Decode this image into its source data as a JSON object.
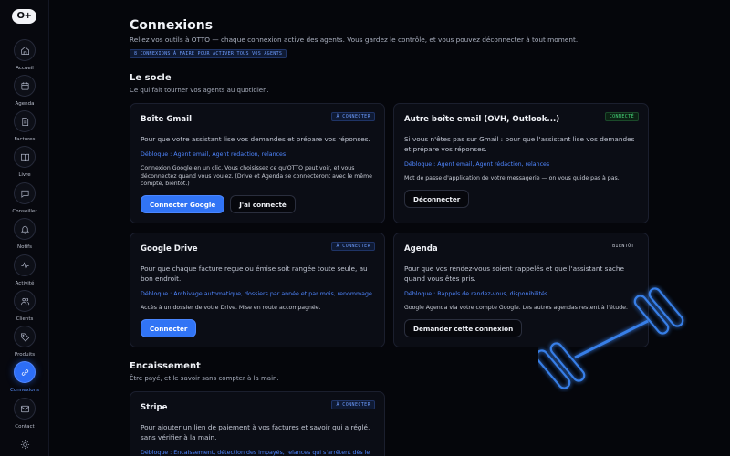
{
  "sidebar": {
    "logo": "O+",
    "items": [
      {
        "label": "Accueil",
        "icon": "home-icon"
      },
      {
        "label": "Agenda",
        "icon": "calendar-icon"
      },
      {
        "label": "Factures",
        "icon": "invoice-icon"
      },
      {
        "label": "Livre",
        "icon": "book-icon"
      },
      {
        "label": "Conseiller",
        "icon": "chat-icon"
      },
      {
        "label": "Notifs",
        "icon": "bell-icon"
      },
      {
        "label": "Activité",
        "icon": "activity-icon"
      },
      {
        "label": "Clients",
        "icon": "users-icon"
      },
      {
        "label": "Produits",
        "icon": "tag-icon"
      },
      {
        "label": "Connexions",
        "icon": "link-icon",
        "active": true
      },
      {
        "label": "Contact",
        "icon": "mail-icon"
      },
      {
        "label": "",
        "icon": "sun-icon"
      }
    ]
  },
  "page": {
    "title": "Connexions",
    "subtitle": "Reliez vos outils à OTTO — chaque connexion active des agents. Vous gardez le contrôle, et vous pouvez déconnecter à tout moment.",
    "count_badge": "8 CONNEXIONS À FAIRE POUR ACTIVER TOUS VOS AGENTS"
  },
  "sections": {
    "socle": {
      "title": "Le socle",
      "subtitle": "Ce qui fait tourner vos agents au quotidien."
    },
    "encaissement": {
      "title": "Encaissement",
      "subtitle": "Être payé, et le savoir sans compter à la main."
    }
  },
  "cards": {
    "gmail": {
      "title": "Boîte Gmail",
      "status": "À CONNECTER",
      "desc": "Pour que votre assistant lise vos demandes et prépare vos réponses.",
      "unlock": "Débloque : Agent email, Agent rédaction, relances",
      "note": "Connexion Google en un clic. Vous choisissez ce qu'OTTO peut voir, et vous déconnectez quand vous voulez. (Drive et Agenda se connecteront avec le même compte, bientôt.)",
      "btn1": "Connecter Google",
      "btn2": "J'ai connecté"
    },
    "other_mail": {
      "title": "Autre boîte email (OVH, Outlook...)",
      "status": "CONNECTÉ",
      "desc": "Si vous n'êtes pas sur Gmail : pour que l'assistant lise vos demandes et prépare vos réponses.",
      "unlock": "Débloque : Agent email, Agent rédaction, relances",
      "note": "Mot de passe d'application de votre messagerie — on vous guide pas à pas.",
      "btn1": "Déconnecter"
    },
    "drive": {
      "title": "Google Drive",
      "status": "À CONNECTER",
      "desc": "Pour que chaque facture reçue ou émise soit rangée toute seule, au bon endroit.",
      "unlock": "Débloque : Archivage automatique, dossiers par année et par mois, renommage",
      "note": "Accès à un dossier de votre Drive. Mise en route accompagnée.",
      "btn1": "Connecter"
    },
    "agenda": {
      "title": "Agenda",
      "status": "BIENTÔT",
      "desc": "Pour que vos rendez-vous soient rappelés et que l'assistant sache quand vous êtes pris.",
      "unlock": "Débloque : Rappels de rendez-vous, disponibilités",
      "note": "Google Agenda via votre compte Google. Les autres agendas restent à l'étude.",
      "btn1": "Demander cette connexion"
    },
    "stripe": {
      "title": "Stripe",
      "status": "À CONNECTER",
      "desc": "Pour ajouter un lien de paiement à vos factures et savoir qui a réglé, sans vérifier à la main.",
      "unlock": "Débloque : Encaissement, détection des impayés, relances qui s'arrêtent dès le"
    }
  },
  "colors": {
    "accent": "#3174f5",
    "connected": "#46d37a",
    "background": "#05060b"
  }
}
